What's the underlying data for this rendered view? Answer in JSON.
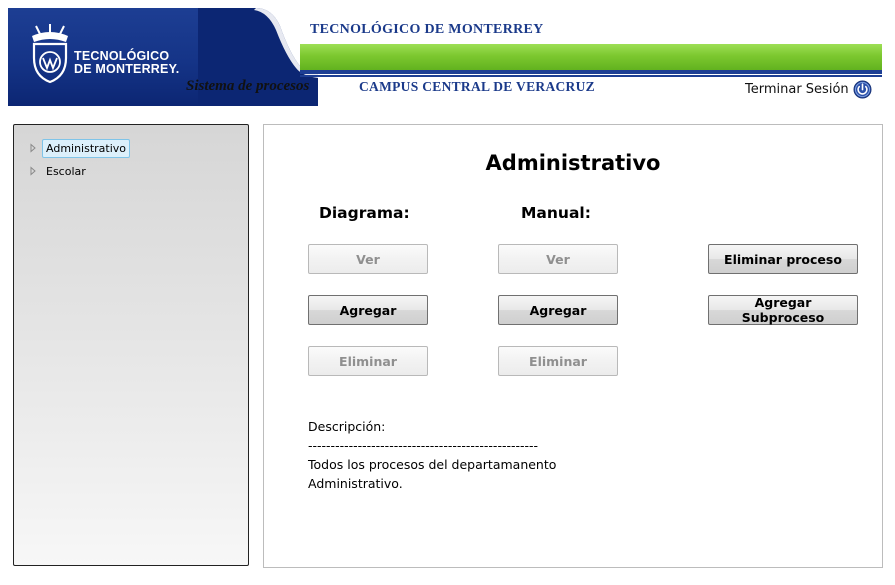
{
  "header": {
    "logo_line1": "TECNOLÓGICO",
    "logo_line2": "DE MONTERREY.",
    "band_title": "TECNOLÓGICO DE MONTERREY",
    "system_name": "Sistema de procesos",
    "campus": "CAMPUS CENTRAL DE VERACRUZ",
    "logout_label": "Terminar Sesión",
    "logout_icon": "power-icon"
  },
  "sidebar": {
    "items": [
      {
        "label": "Administrativo",
        "selected": true
      },
      {
        "label": "Escolar",
        "selected": false
      }
    ]
  },
  "main": {
    "title": "Administrativo",
    "diagrama": {
      "heading": "Diagrama:",
      "ver": "Ver",
      "agregar": "Agregar",
      "eliminar": "Eliminar"
    },
    "manual": {
      "heading": "Manual:",
      "ver": "Ver",
      "agregar": "Agregar",
      "eliminar": "Eliminar"
    },
    "actions": {
      "eliminar_proceso": "Eliminar proceso",
      "agregar_subproceso": "Agregar Subproceso"
    },
    "description": {
      "label": "Descripción:",
      "separator": "---------------------------------------------------",
      "line1": "Todos los procesos del departamanento",
      "line2": "Administrativo."
    }
  },
  "colors": {
    "brand_blue": "#1d3e93",
    "brand_green": "#7cc82f",
    "selection": "#dcf0fb"
  }
}
